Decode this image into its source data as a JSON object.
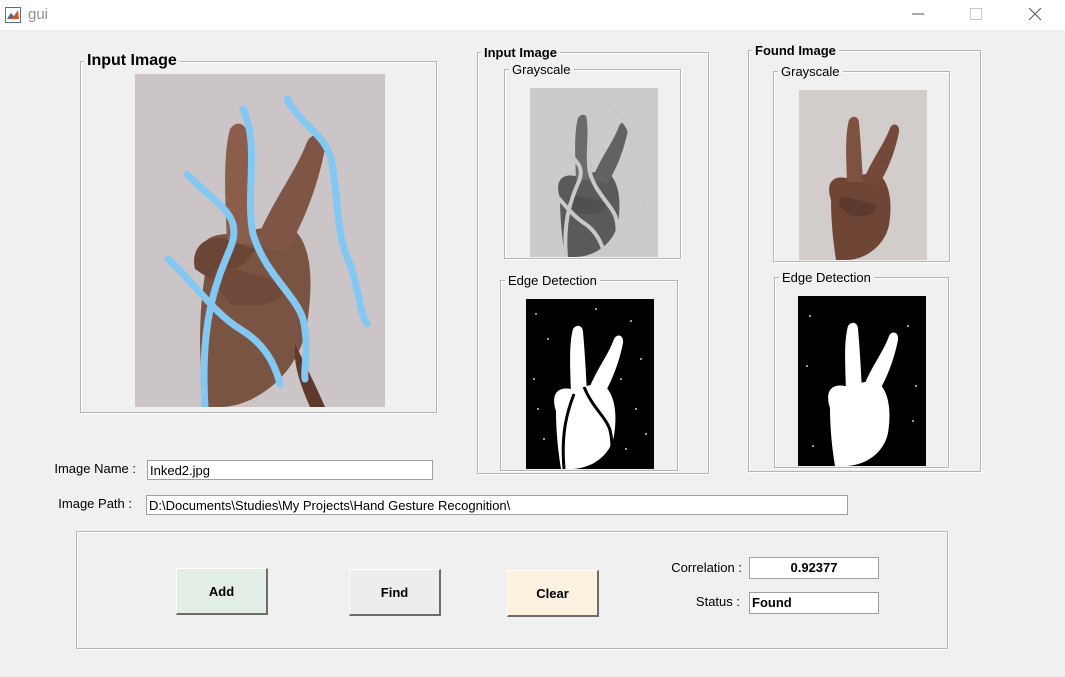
{
  "window": {
    "title": "gui",
    "icon": "matlab-icon"
  },
  "panels": {
    "input_image": {
      "title": "Input Image"
    },
    "input_processed": {
      "title": "Input Image",
      "grayscale": "Grayscale",
      "edge": "Edge Detection"
    },
    "found_image": {
      "title": "Found Image",
      "grayscale": "Grayscale",
      "edge": "Edge Detection"
    }
  },
  "fields": {
    "image_name_label": "Image Name :",
    "image_name_value": "Inked2.jpg",
    "image_path_label": "Image Path :",
    "image_path_value": "D:\\Documents\\Studies\\My Projects\\Hand Gesture Recognition\\"
  },
  "controls": {
    "add_label": "Add",
    "find_label": "Find",
    "clear_label": "Clear",
    "correlation_label": "Correlation :",
    "correlation_value": "0.92377",
    "status_label": "Status :",
    "status_value": "Found"
  },
  "colors": {
    "add_button": "#e3efe6",
    "find_button": "#ededed",
    "clear_button": "#fdf1df",
    "ink": "#82c8f2"
  }
}
